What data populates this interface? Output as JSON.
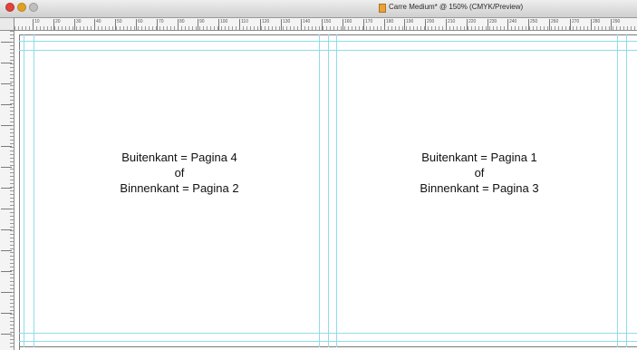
{
  "window": {
    "title": "Carre Medium* @ 150% (CMYK/Preview)"
  },
  "ruler": {
    "top_labels": [
      "10",
      "20",
      "30",
      "40",
      "50",
      "60",
      "70",
      "80",
      "90",
      "100",
      "110",
      "120",
      "130",
      "140",
      "150",
      "160",
      "170",
      "180",
      "190",
      "200",
      "210",
      "220",
      "230",
      "240",
      "250",
      "260",
      "270",
      "280",
      "290"
    ]
  },
  "pages": {
    "left": {
      "line1": "Buitenkant = Pagina 4",
      "line2": "of",
      "line3": "Binnenkant = Pagina 2"
    },
    "right": {
      "line1": "Buitenkant = Pagina 1",
      "line2": "of",
      "line3": "Binnenkant = Pagina 3"
    }
  },
  "colors": {
    "guide": "#8fdcec",
    "close": "#e0443e",
    "minimize": "#dea123"
  }
}
